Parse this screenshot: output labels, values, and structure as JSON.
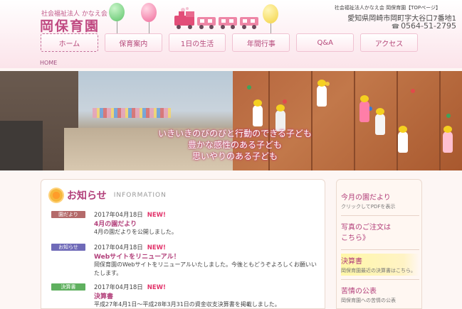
{
  "header": {
    "org_name": "社会福祉法人 かなえ会",
    "site_title": "岡保育園",
    "top_link": "社会福祉法人かなえ会 岡保育園【TOPページ】",
    "address": "愛知県岡崎市岡町字大谷口7番地1",
    "phone": "0564-51-2795"
  },
  "nav": {
    "items": [
      "ホーム",
      "保育案内",
      "1日の生活",
      "年間行事",
      "Q&A",
      "アクセス"
    ]
  },
  "breadcrumb": "HOME",
  "hero": {
    "lines": [
      "いきいきのびのびと行動のできる子ども",
      "豊かな感性のある子ども",
      "思いやりのある子ども"
    ]
  },
  "news": {
    "title": "お知らせ",
    "subtitle": "INFORMATION",
    "items": [
      {
        "badge": "園だより",
        "badge_color": "#b46a6a",
        "date": "2017年04月18日",
        "new": "NEW!",
        "title": "4月の園だより",
        "body": "4月の園だよりを公開しました。"
      },
      {
        "badge": "お知らせ",
        "badge_color": "#6f6ab8",
        "date": "2017年04月18日",
        "new": "NEW!",
        "title": "Webサイトをリニューアル！",
        "body": "岡保育園のWebサイトをリニューアルいたしました。今後ともどうぞよろしくお願いいたします。"
      },
      {
        "badge": "決算書",
        "badge_color": "#5fb05f",
        "date": "2017年04月18日",
        "new": "NEW!",
        "title": "決算書",
        "body": "平成27年4月1日〜平成28年3月31日の資金収支決算書を掲載しました。"
      }
    ]
  },
  "sidebar": {
    "items": [
      {
        "title": "今月の園だより",
        "sub": "クリックしてPDFを表示"
      },
      {
        "title": "写真のご注文は",
        "title2": "こちら》",
        "sub": ""
      },
      {
        "title": "決算書",
        "sub": "岡保育園最近の決算書はこちら。"
      },
      {
        "title": "苦情の公表",
        "sub": "岡保育園への苦情の公表"
      }
    ]
  }
}
